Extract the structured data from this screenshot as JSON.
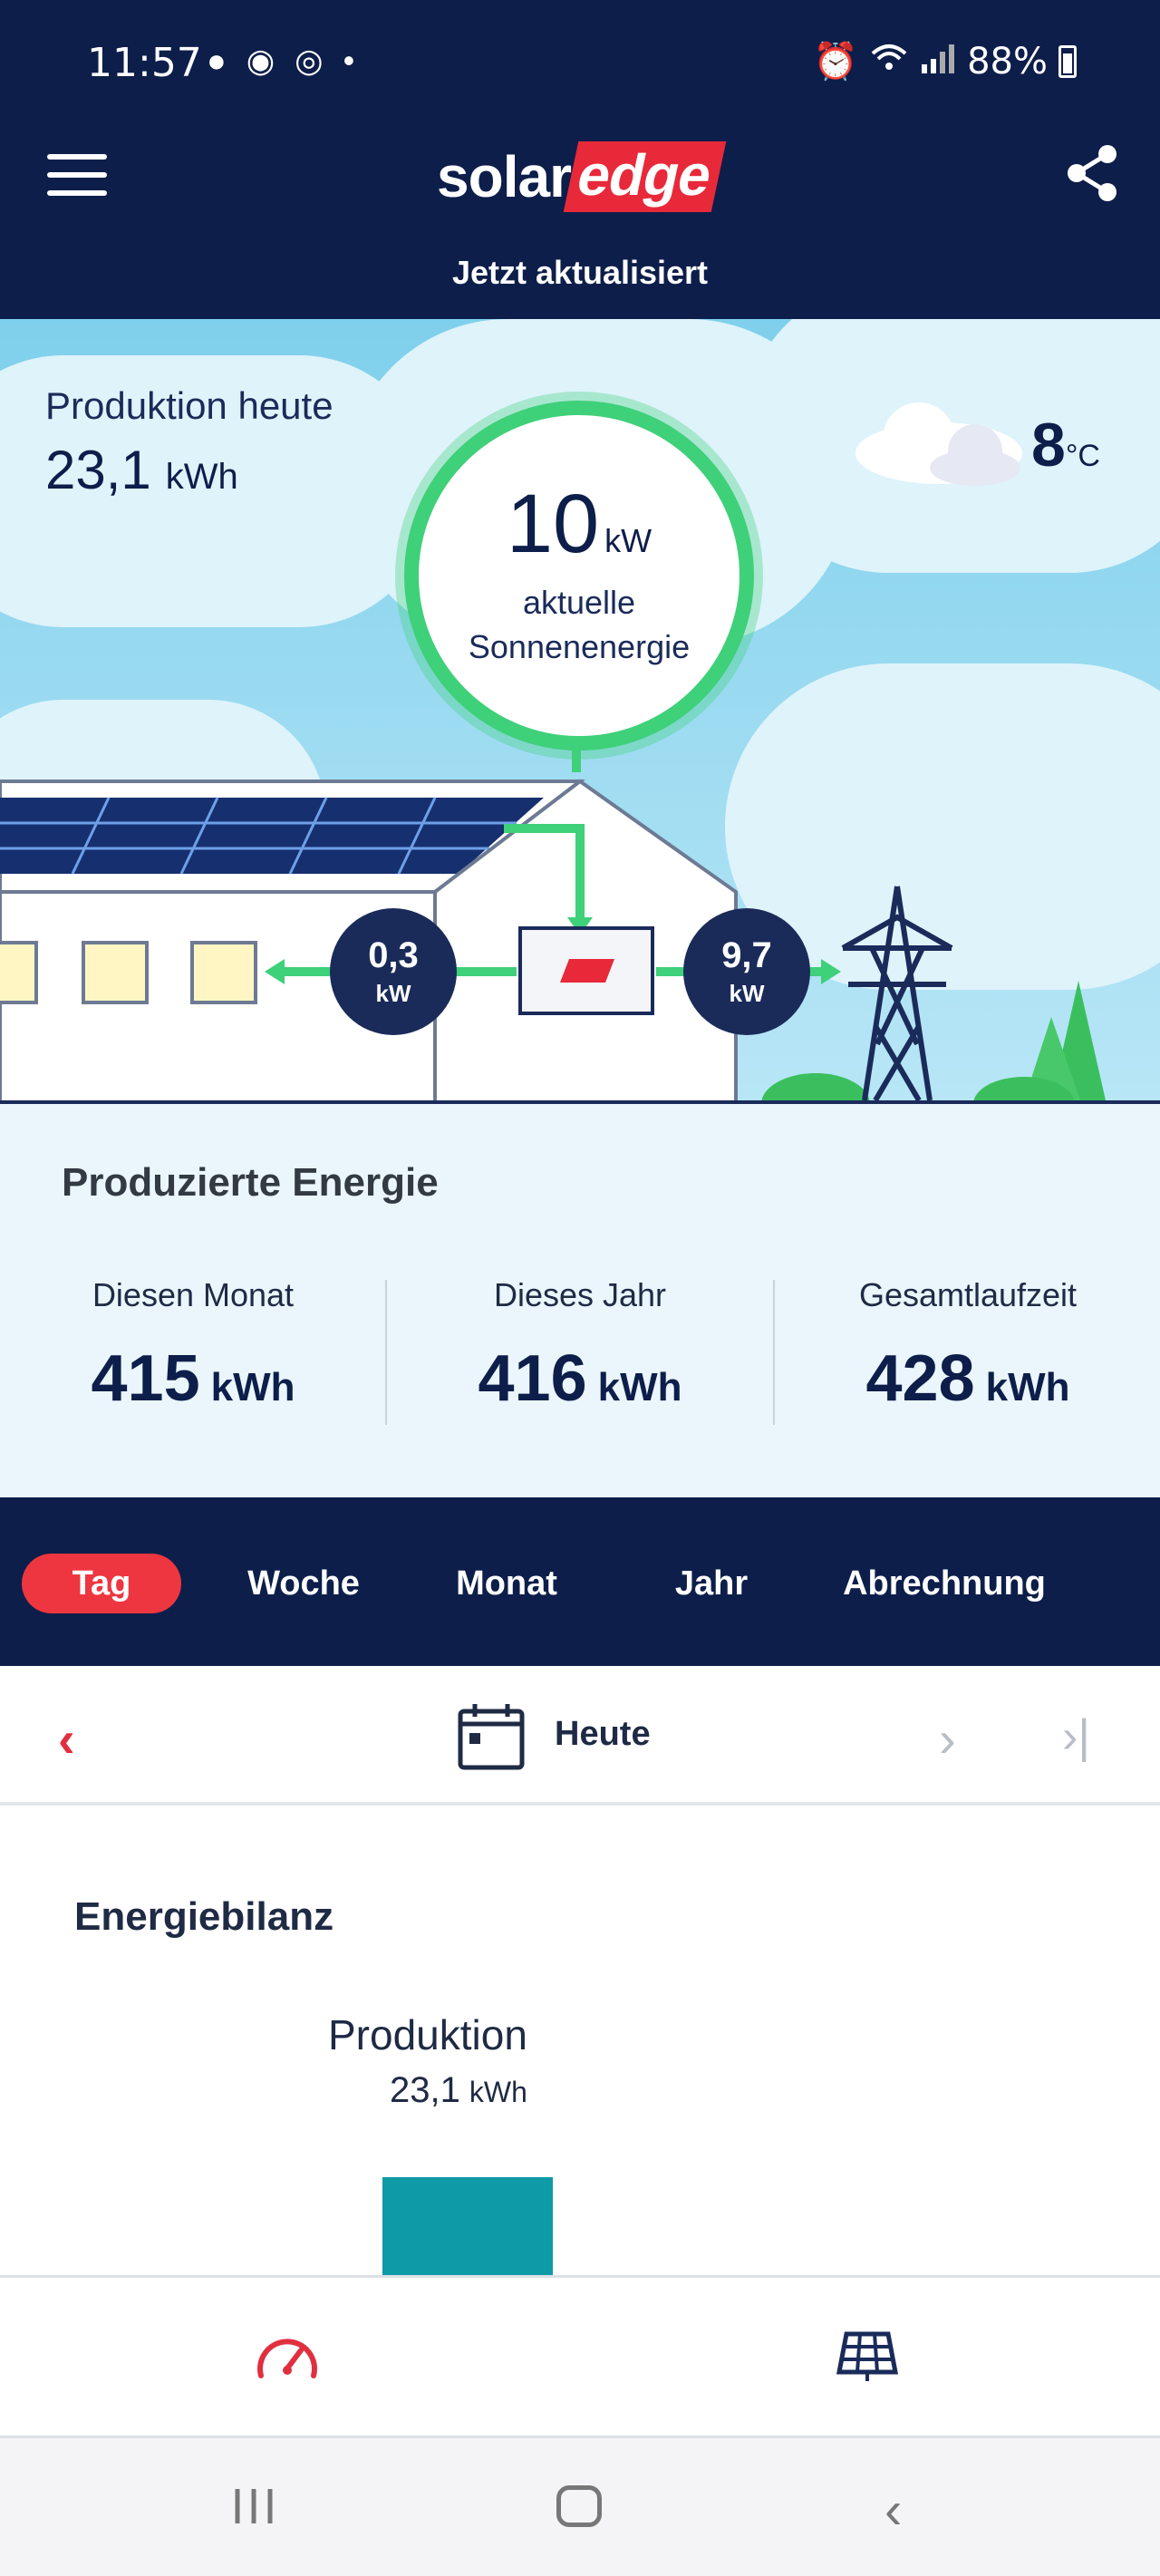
{
  "status_bar": {
    "time": "11:57",
    "battery": "88%"
  },
  "header": {
    "logo_solar": "solar",
    "logo_edge": "edge",
    "updated": "Jetzt aktualisiert"
  },
  "hero": {
    "production_label": "Produktion heute",
    "production_value": "23,1",
    "production_unit": "kWh",
    "temperature": "8",
    "temperature_unit": "°C",
    "current_power": "10",
    "current_power_unit": "kW",
    "current_power_label_1": "aktuelle",
    "current_power_label_2": "Sonnenenergie",
    "consumption_value": "0,3",
    "consumption_unit": "kW",
    "grid_value": "9,7",
    "grid_unit": "kW"
  },
  "produced": {
    "title": "Produzierte Energie",
    "stats": [
      {
        "label": "Diesen Monat",
        "value": "415",
        "unit": "kWh"
      },
      {
        "label": "Dieses Jahr",
        "value": "416",
        "unit": "kWh"
      },
      {
        "label": "Gesamtlaufzeit",
        "value": "428",
        "unit": "kWh"
      }
    ]
  },
  "tabs": [
    {
      "label": "Tag",
      "active": true
    },
    {
      "label": "Woche",
      "active": false
    },
    {
      "label": "Monat",
      "active": false
    },
    {
      "label": "Jahr",
      "active": false
    },
    {
      "label": "Abrechnung",
      "active": false
    }
  ],
  "date_nav": {
    "prev": "‹",
    "current": "Heute",
    "next": "›",
    "last": "›|"
  },
  "balance": {
    "title": "Energiebilanz",
    "production_label": "Produktion",
    "production_value": "23,1",
    "production_unit": "kWh"
  },
  "colors": {
    "navy": "#0d1e4a",
    "accent_red": "#ee3640",
    "flow_green": "#3fd07a",
    "bar_teal": "#0e9aa7"
  },
  "bottom_nav": {
    "items": [
      "dashboard-icon",
      "solar-panel-icon"
    ]
  }
}
